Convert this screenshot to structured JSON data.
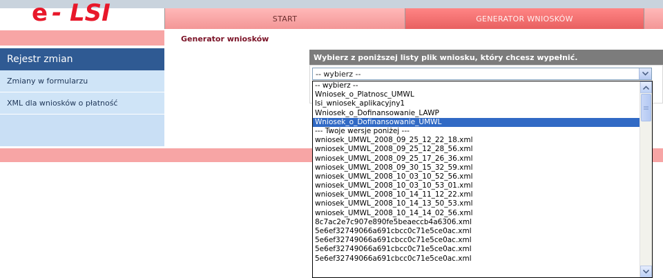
{
  "app": {
    "logo_e": "e",
    "logo_text": "- LSI",
    "brand_color": "#e8182a"
  },
  "nav": {
    "tabs": [
      {
        "label": "START"
      },
      {
        "label": "GENERATOR WNIOSKÓW",
        "active": true
      }
    ]
  },
  "breadcrumb": "Generator wniosków",
  "sidebar": {
    "title": "Rejestr zmian",
    "items": [
      {
        "label": "Zmiany w formularzu"
      },
      {
        "label": "XML dla wniosków o płatność"
      }
    ]
  },
  "form": {
    "instruction": "Wybierz z poniższej listy plik wniosku, który chcesz wypełnić.",
    "select_value": "-- wybierz --",
    "options": [
      "-- wybierz --",
      "Wniosek_o_Platnosc_UMWL",
      "lsi_wniosek_aplikacyjny1",
      "Wniosek_o_Dofinansowanie_LAWP",
      "Wniosek_o_Dofinansowanie_UMWL",
      "--- Twoje wersje poniżej ---",
      "wniosek_UMWL_2008_09_25_12_22_18.xml",
      "wniosek_UMWL_2008_09_25_12_28_56.xml",
      "wniosek_UMWL_2008_09_25_17_26_36.xml",
      "wniosek_UMWL_2008_09_30_15_32_59.xml",
      "wniosek_UMWL_2008_10_03_10_52_56.xml",
      "wniosek_UMWL_2008_10_03_10_53_01.xml",
      "wniosek_UMWL_2008_10_14_11_12_22.xml",
      "wniosek_UMWL_2008_10_14_13_50_53.xml",
      "wniosek_UMWL_2008_10_14_14_02_56.xml",
      "8c7ac2e7c907e890fe5beaeccb4a6306.xml",
      "5e6ef32749066a691cbcc0c71e5ce0ac.xml",
      "5e6ef32749066a691cbcc0c71e5ce0ac.xml",
      "5e6ef32749066a691cbcc0c71e5ce0ac.xml",
      "5e6ef32749066a691cbcc0c71e5ce0ac.xml"
    ],
    "highlighted_option": "Wniosek_o_Dofinansowanie_UMWL"
  },
  "icons": {
    "select_arrow": "chevron-down-icon",
    "scroll_up": "scroll-up-arrow-icon",
    "scroll_down": "scroll-down-arrow-icon"
  }
}
